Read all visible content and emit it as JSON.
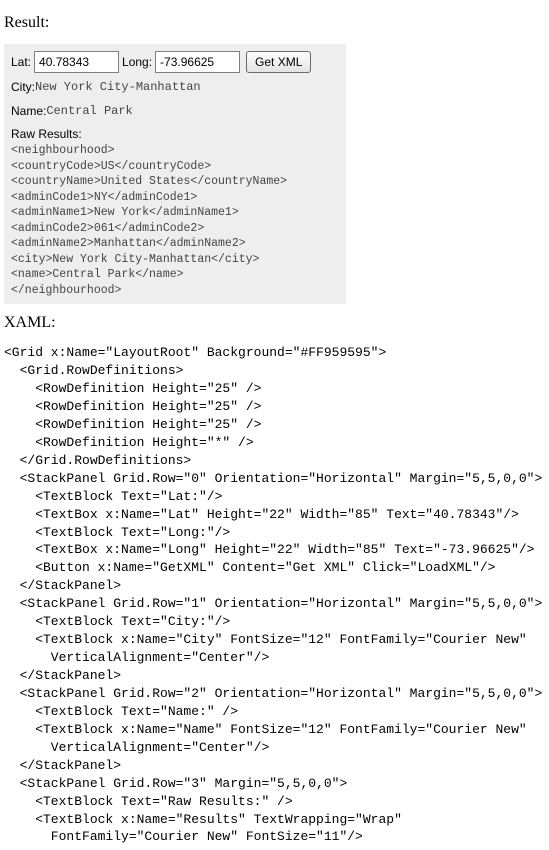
{
  "headings": {
    "result": "Result:",
    "xaml": "XAML:"
  },
  "form": {
    "lat_label": "Lat:",
    "lat_value": "40.78343",
    "long_label": "Long:",
    "long_value": "-73.96625",
    "get_xml_label": "Get XML",
    "city_label": "City:",
    "city_value": "New York City-Manhattan",
    "name_label": "Name:",
    "name_value": "Central Park",
    "raw_label": "Raw Results:",
    "raw_results": "<neighbourhood>\n<countryCode>US</countryCode>\n<countryName>United States</countryName>\n<adminCode1>NY</adminCode1>\n<adminName1>New York</adminName1>\n<adminCode2>061</adminCode2>\n<adminName2>Manhattan</adminName2>\n<city>New York City-Manhattan</city>\n<name>Central Park</name>\n</neighbourhood>"
  },
  "xaml_code": "<Grid x:Name=\"LayoutRoot\" Background=\"#FF959595\">\n  <Grid.RowDefinitions>\n    <RowDefinition Height=\"25\" />\n    <RowDefinition Height=\"25\" />\n    <RowDefinition Height=\"25\" />\n    <RowDefinition Height=\"*\" />\n  </Grid.RowDefinitions>\n  <StackPanel Grid.Row=\"0\" Orientation=\"Horizontal\" Margin=\"5,5,0,0\">\n    <TextBlock Text=\"Lat:\"/>\n    <TextBox x:Name=\"Lat\" Height=\"22\" Width=\"85\" Text=\"40.78343\"/>\n    <TextBlock Text=\"Long:\"/>\n    <TextBox x:Name=\"Long\" Height=\"22\" Width=\"85\" Text=\"-73.96625\"/>\n    <Button x:Name=\"GetXML\" Content=\"Get XML\" Click=\"LoadXML\"/>\n  </StackPanel>\n  <StackPanel Grid.Row=\"1\" Orientation=\"Horizontal\" Margin=\"5,5,0,0\">\n    <TextBlock Text=\"City:\"/>\n    <TextBlock x:Name=\"City\" FontSize=\"12\" FontFamily=\"Courier New\"\n      VerticalAlignment=\"Center\"/>\n  </StackPanel>\n  <StackPanel Grid.Row=\"2\" Orientation=\"Horizontal\" Margin=\"5,5,0,0\">\n    <TextBlock Text=\"Name:\" />\n    <TextBlock x:Name=\"Name\" FontSize=\"12\" FontFamily=\"Courier New\"\n      VerticalAlignment=\"Center\"/>\n  </StackPanel>\n  <StackPanel Grid.Row=\"3\" Margin=\"5,5,0,0\">\n    <TextBlock Text=\"Raw Results:\" />\n    <TextBlock x:Name=\"Results\" TextWrapping=\"Wrap\"\n      FontFamily=\"Courier New\" FontSize=\"11\"/>"
}
